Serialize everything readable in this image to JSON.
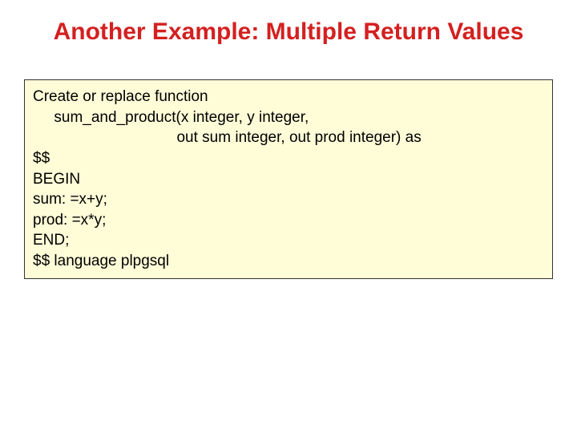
{
  "title": "Another Example: Multiple Return Values",
  "code": {
    "lines": [
      "Create or replace function",
      "     sum_and_product(x integer, y integer,",
      "                                  out sum integer, out prod integer) as",
      "$$",
      "BEGIN",
      "sum: =x+y;",
      "prod: =x*y;",
      "END;",
      "$$ language plpgsql"
    ]
  }
}
